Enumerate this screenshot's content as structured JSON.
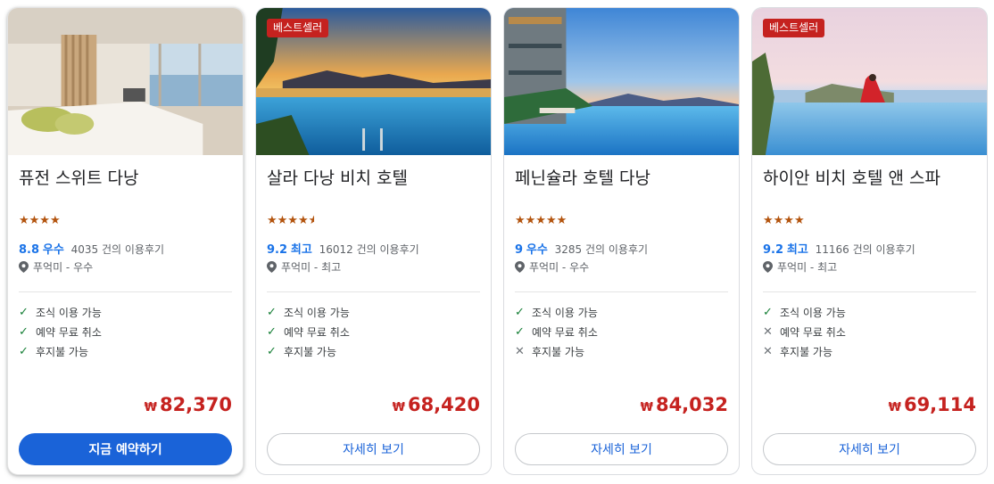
{
  "hotels": [
    {
      "name": "퓨전 스위트 다낭",
      "badge": "",
      "stars": "★★★★",
      "score": "8.8",
      "score_word": "우수",
      "reviews": "4035 건의 이용후기",
      "location": "푸억미 - 우수",
      "amenities": [
        {
          "label": "조식 이용 가능",
          "available": true
        },
        {
          "label": "예약 무료 취소",
          "available": true
        },
        {
          "label": "후지불 가능",
          "available": true
        }
      ],
      "currency": "₩",
      "price": "82,370",
      "button": "지금 예약하기"
    },
    {
      "name": "살라 다낭 비치 호텔",
      "badge": "베스트셀러",
      "stars": "★★★★",
      "half_star": "★",
      "score": "9.2",
      "score_word": "최고",
      "reviews": "16012 건의 이용후기",
      "location": "푸억미 - 최고",
      "amenities": [
        {
          "label": "조식 이용 가능",
          "available": true
        },
        {
          "label": "예약 무료 취소",
          "available": true
        },
        {
          "label": "후지불 가능",
          "available": true
        }
      ],
      "currency": "₩",
      "price": "68,420",
      "button": "자세히 보기"
    },
    {
      "name": "페닌슐라 호텔 다낭",
      "badge": "",
      "stars": "★★★★★",
      "score": "9",
      "score_word": "우수",
      "reviews": "3285 건의 이용후기",
      "location": "푸억미 - 우수",
      "amenities": [
        {
          "label": "조식 이용 가능",
          "available": true
        },
        {
          "label": "예약 무료 취소",
          "available": true
        },
        {
          "label": "후지불 가능",
          "available": false
        }
      ],
      "currency": "₩",
      "price": "84,032",
      "button": "자세히 보기"
    },
    {
      "name": "하이안 비치 호텔 앤 스파",
      "badge": "베스트셀러",
      "stars": "★★★★",
      "score": "9.2",
      "score_word": "최고",
      "reviews": "11166 건의 이용후기",
      "location": "푸억미 - 최고",
      "amenities": [
        {
          "label": "조식 이용 가능",
          "available": true
        },
        {
          "label": "예약 무료 취소",
          "available": false
        },
        {
          "label": "후지불 가능",
          "available": false
        }
      ],
      "currency": "₩",
      "price": "69,114",
      "button": "자세히 보기"
    }
  ],
  "colors": {
    "price": "#c5221f",
    "badge": "#c5221f",
    "star": "#b3540e",
    "score": "#1a73e8",
    "check": "#188038",
    "primary_button": "#1a63d8"
  },
  "icons": {
    "location": "map-pin-icon",
    "available": "check-icon",
    "unavailable": "cross-icon"
  }
}
